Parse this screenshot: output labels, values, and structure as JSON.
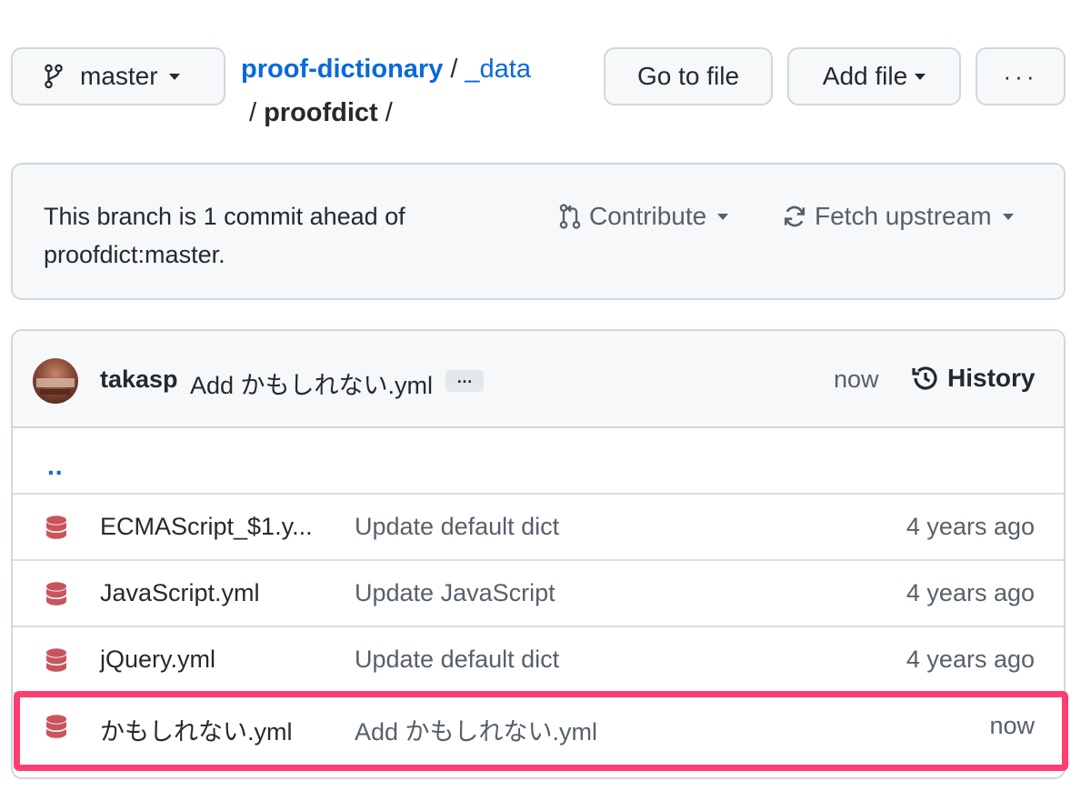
{
  "branch": {
    "name": "master"
  },
  "breadcrumb": {
    "repo": "proof-dictionary",
    "sep1": "/",
    "dir1": "_data",
    "sep2": "/",
    "current": "proofdict",
    "sep3": "/"
  },
  "toolbar": {
    "goto_label": "Go to file",
    "addfile_label": "Add file",
    "more_label": "···"
  },
  "ahead": {
    "message": "This branch is 1 commit ahead of proofdict:master.",
    "contribute_label": "Contribute",
    "fetch_label": "Fetch upstream"
  },
  "latest_commit": {
    "author": "takasp",
    "message": "Add かもしれない.yml",
    "ellipsis": "…",
    "time": "now",
    "history_label": "History"
  },
  "parent_link": "..",
  "files": [
    {
      "name": "ECMAScript_$1.y...",
      "message": "Update default dict",
      "time": "4 years ago",
      "icon": "database-icon"
    },
    {
      "name": "JavaScript.yml",
      "message": "Update JavaScript",
      "time": "4 years ago",
      "icon": "database-icon"
    },
    {
      "name": "jQuery.yml",
      "message": "Update default dict",
      "time": "4 years ago",
      "icon": "database-icon"
    },
    {
      "name": "かもしれない.yml",
      "message": "Add かもしれない.yml",
      "time": "now",
      "icon": "database-icon"
    }
  ],
  "colors": {
    "link": "#0969da",
    "highlight": "#ff3d73",
    "file_icon": "#c9555c",
    "muted": "#57606a"
  }
}
